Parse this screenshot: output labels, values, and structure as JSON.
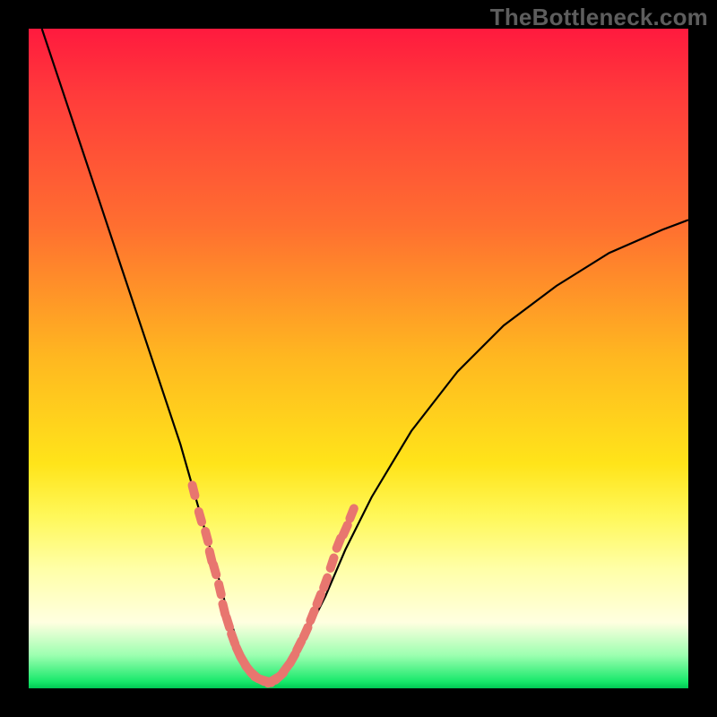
{
  "watermark": "TheBottleneck.com",
  "colors": {
    "frame": "#000000",
    "curve": "#000000",
    "markers": "#e8766f",
    "gradient_stops": [
      "#ff1a3e",
      "#ff3b3b",
      "#ff6f30",
      "#ffb820",
      "#ffe41a",
      "#fff85a",
      "#ffffa8",
      "#ffffe0",
      "#9cffb0",
      "#17e86a",
      "#00c853"
    ]
  },
  "chart_data": {
    "type": "line",
    "title": "",
    "xlabel": "",
    "ylabel": "",
    "xlim": [
      0,
      100
    ],
    "ylim": [
      0,
      100
    ],
    "series": [
      {
        "name": "bottleneck-curve",
        "x": [
          2,
          5,
          8,
          11,
          14,
          17,
          20,
          23,
          25,
          27,
          29,
          30,
          31,
          32,
          33,
          34,
          35,
          36,
          37,
          38.5,
          40,
          42,
          45,
          48,
          52,
          58,
          65,
          72,
          80,
          88,
          96,
          100
        ],
        "y": [
          100,
          91,
          82,
          73,
          64,
          55,
          46,
          37,
          30,
          23,
          16,
          12,
          9,
          6,
          4,
          2.5,
          1.5,
          1,
          1.2,
          2,
          4,
          8,
          14,
          21,
          29,
          39,
          48,
          55,
          61,
          66,
          69.5,
          71
        ]
      }
    ],
    "markers": {
      "name": "highlight-segments",
      "description": "salmon dashed capsule markers near the valley",
      "points_left": [
        [
          25,
          30
        ],
        [
          26,
          26
        ],
        [
          27,
          23
        ],
        [
          27.6,
          20
        ],
        [
          28.2,
          18
        ],
        [
          29,
          15
        ],
        [
          29.6,
          12
        ],
        [
          30.2,
          10
        ],
        [
          31,
          7.5
        ],
        [
          31.8,
          5.5
        ],
        [
          32.6,
          4
        ],
        [
          33.4,
          2.8
        ],
        [
          34.2,
          2
        ],
        [
          35,
          1.4
        ],
        [
          36,
          1.1
        ]
      ],
      "points_right": [
        [
          37,
          1.2
        ],
        [
          38,
          1.8
        ],
        [
          39,
          3
        ],
        [
          40,
          4.5
        ],
        [
          41,
          6.5
        ],
        [
          42,
          8.5
        ],
        [
          43,
          11
        ],
        [
          44,
          13.5
        ],
        [
          45,
          16
        ],
        [
          46,
          19
        ],
        [
          47,
          22
        ],
        [
          48,
          24
        ],
        [
          49,
          26.5
        ]
      ]
    }
  }
}
